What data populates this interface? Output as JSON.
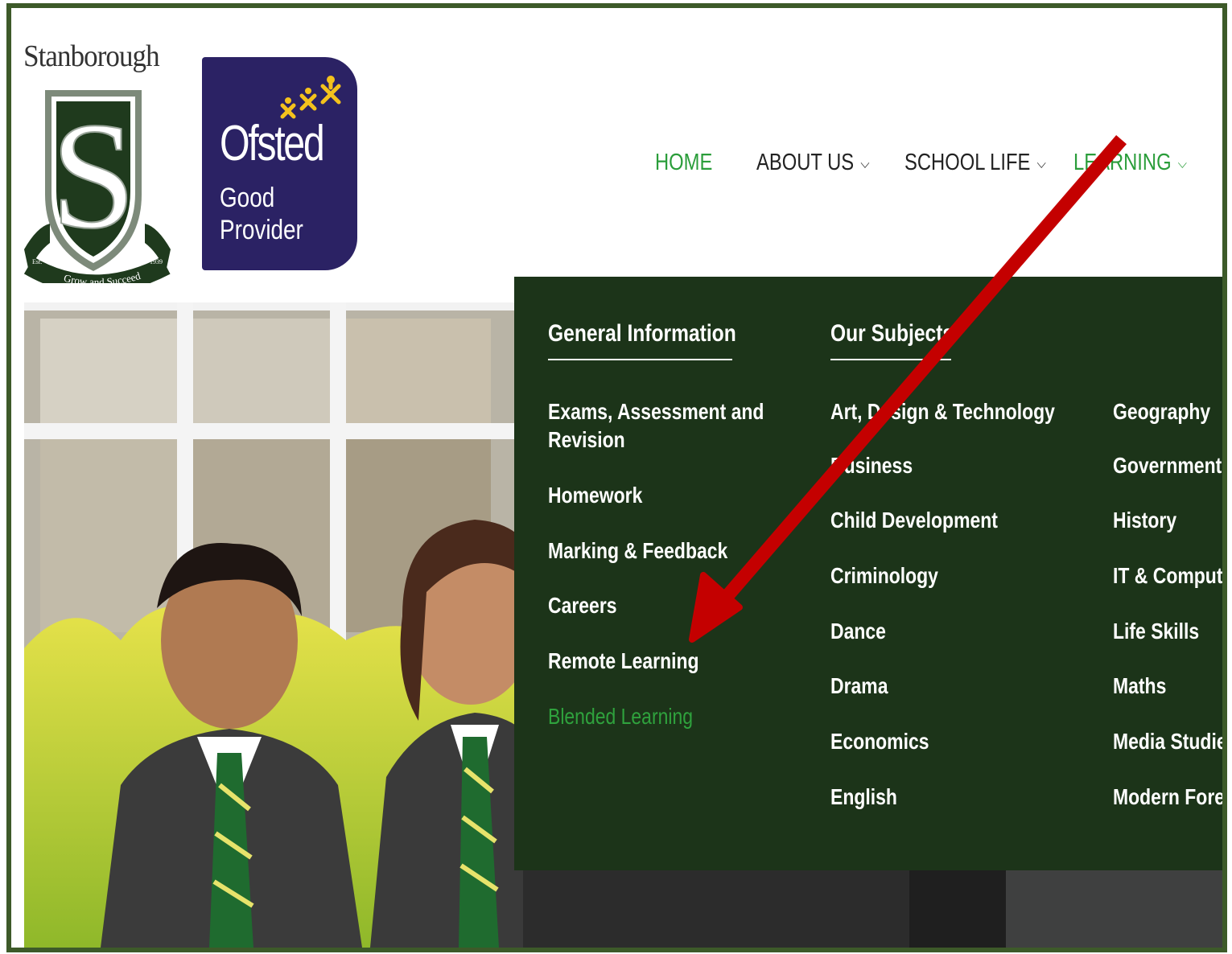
{
  "logo": {
    "wordmark": "Stanborough",
    "motto": "Grow and Succeed",
    "est_left": "Est.",
    "est_right": "1939"
  },
  "ofsted": {
    "name": "Ofsted",
    "rating_line1": "Good",
    "rating_line2": "Provider",
    "bg_color": "#2b2264",
    "star_color": "#f4c21c"
  },
  "nav": {
    "items": [
      {
        "label": "HOME",
        "has_dropdown": false,
        "active": true
      },
      {
        "label": "ABOUT US",
        "has_dropdown": true,
        "active": false
      },
      {
        "label": "SCHOOL LIFE",
        "has_dropdown": true,
        "active": false
      },
      {
        "label": "LEARNING",
        "has_dropdown": true,
        "active": true
      }
    ],
    "active_color": "#2a9d3a"
  },
  "mega_menu": {
    "bg_color": "#1c3419",
    "general": {
      "heading": "General Information",
      "links": [
        {
          "line1": "Exams, Assessment and",
          "line2": "Revision"
        },
        {
          "line1": "Homework"
        },
        {
          "line1": "Marking & Feedback"
        },
        {
          "line1": "Careers"
        },
        {
          "line1": "Remote Learning"
        },
        {
          "line1": "Blended Learning",
          "current": true
        }
      ]
    },
    "subjects": {
      "heading": "Our Subjects",
      "column1": [
        "Art, Design & Technology",
        "Business",
        "Child Development",
        "Criminology",
        "Dance",
        "Drama",
        "Economics",
        "English"
      ],
      "column2": [
        "Geography",
        "Government",
        "History",
        "IT & Computer",
        "Life Skills",
        "Maths",
        "Media Studies",
        "Modern Foreign"
      ]
    }
  },
  "annotation": {
    "arrow_color": "#c40000"
  }
}
